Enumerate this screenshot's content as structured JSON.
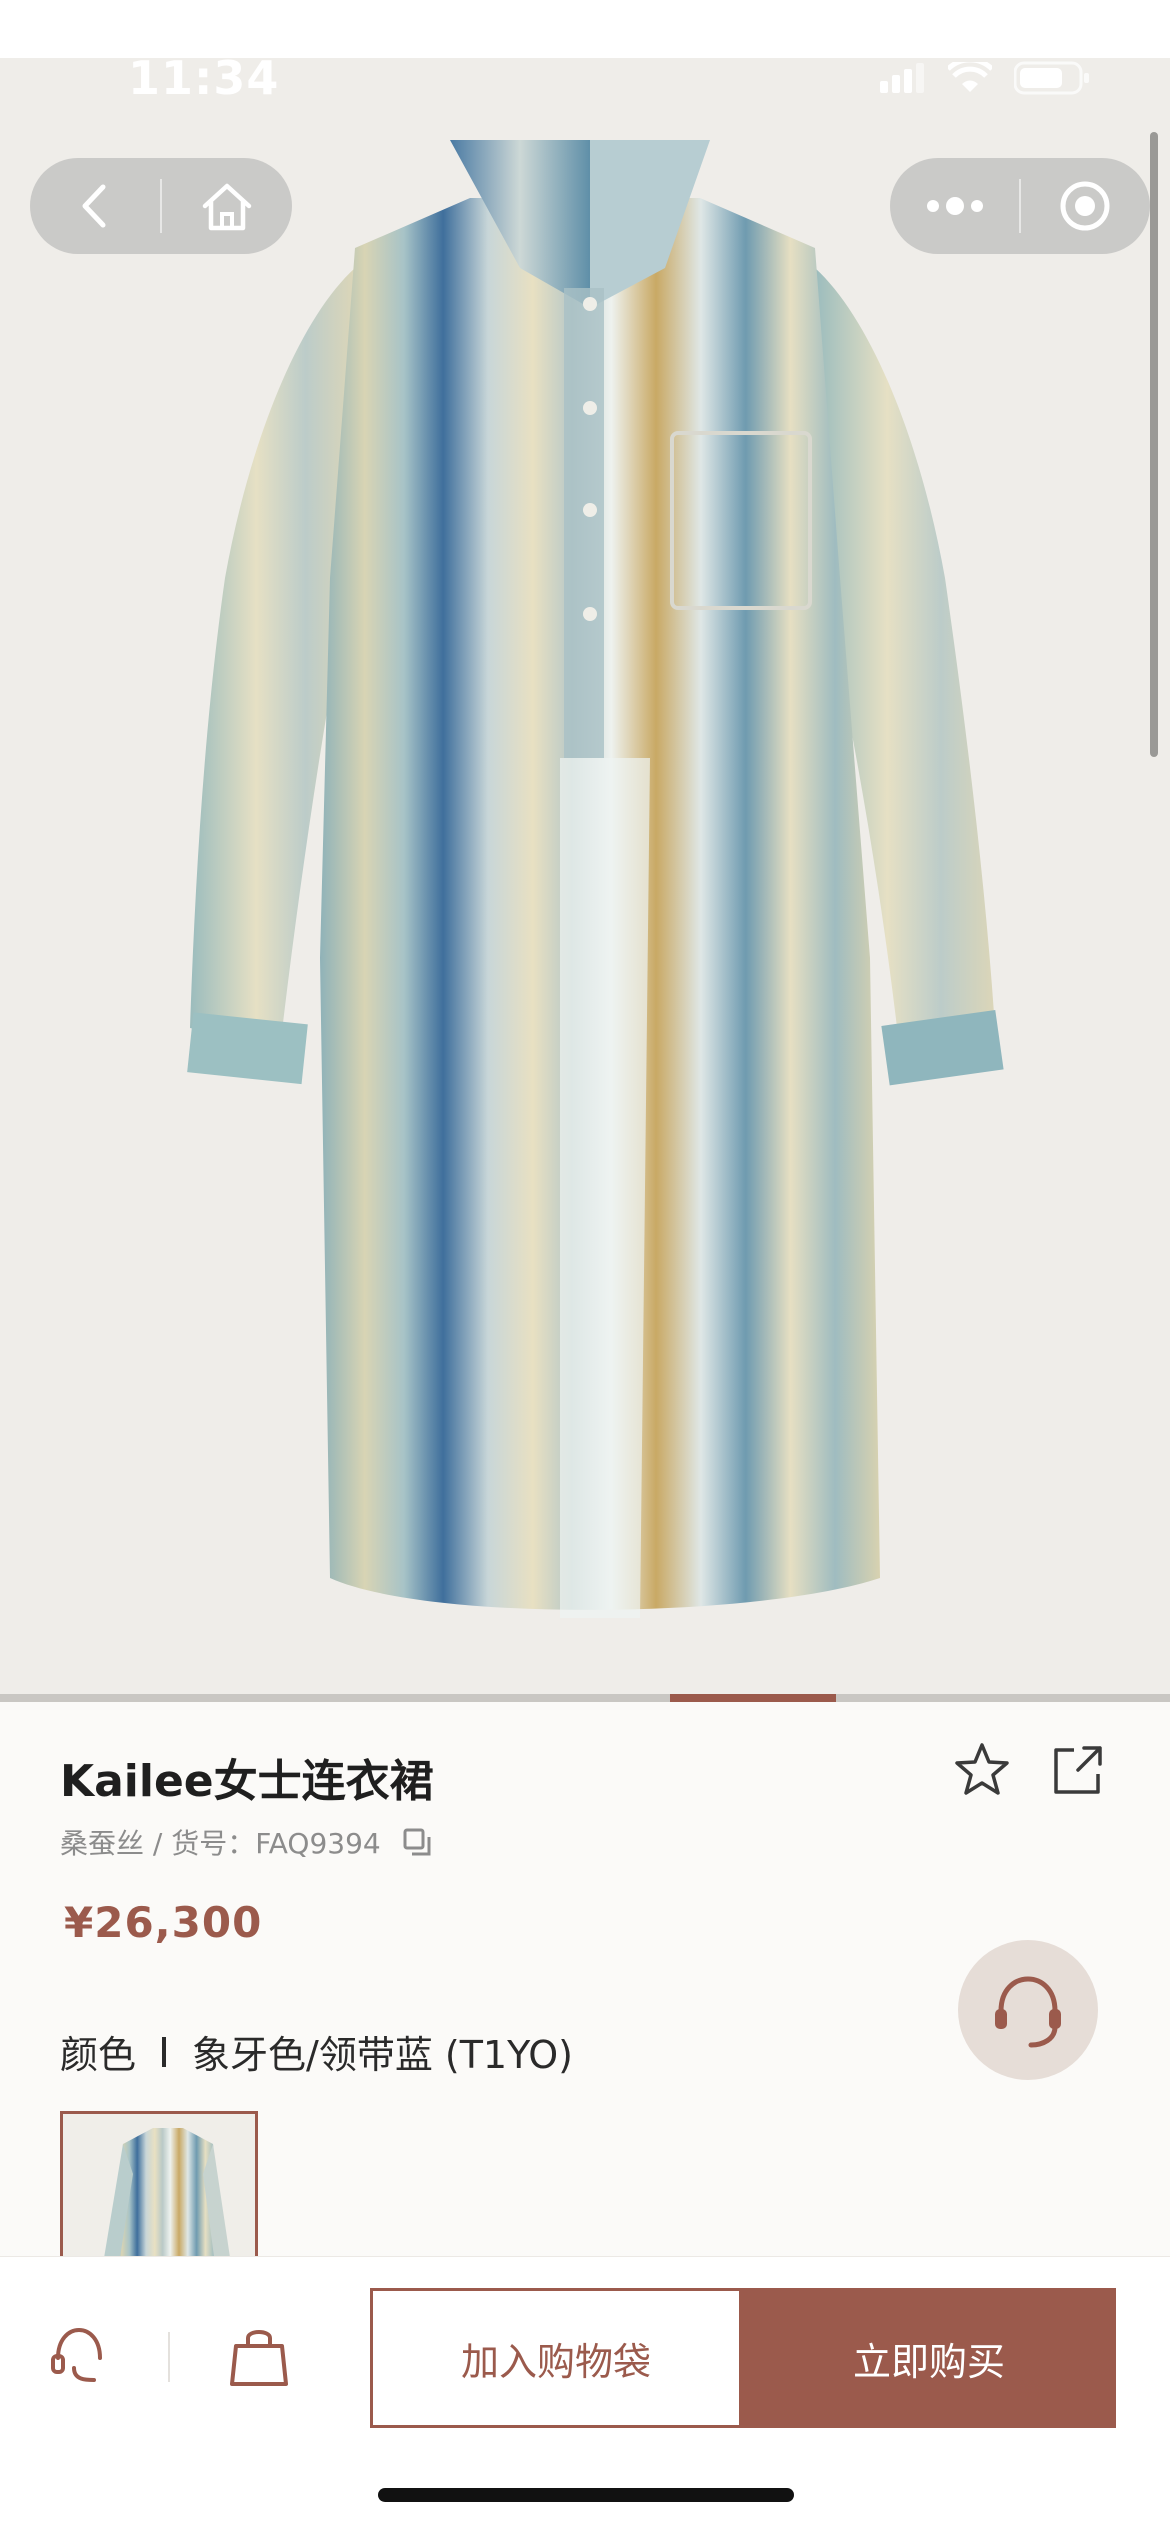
{
  "status_bar": {
    "time": "11:34"
  },
  "product": {
    "name": "Kailee女士连衣裙",
    "meta": "桑蚕丝 / 货号：FAQ9394",
    "price": "¥26,300",
    "color_label": "颜色",
    "color_value": "象牙色/领带蓝 (T1YO)"
  },
  "image_gallery": {
    "current_index_fraction": 0.57
  },
  "actions": {
    "add_to_cart": "加入购物袋",
    "buy_now": "立即购买"
  },
  "colors": {
    "accent": "#9b5a4c",
    "image_background": "#efede9"
  },
  "icons": [
    "back-icon",
    "home-icon",
    "more-dots-icon",
    "record-icon",
    "star-icon",
    "share-icon",
    "copy-icon",
    "customer-service-icon",
    "shopping-bag-icon"
  ]
}
